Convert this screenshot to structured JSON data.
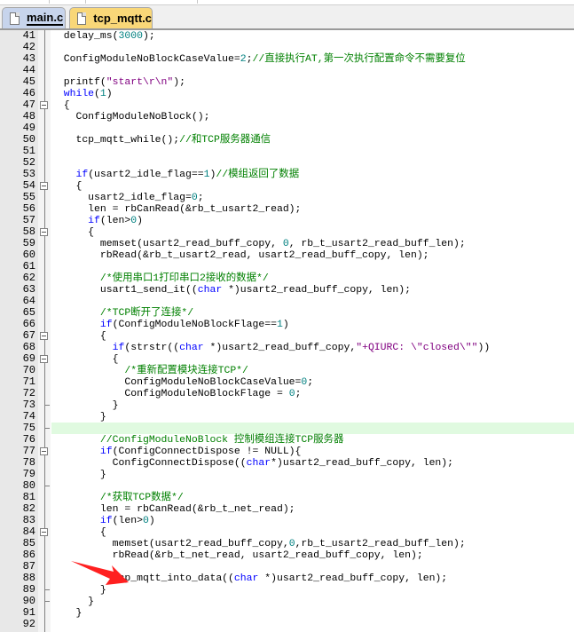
{
  "tabs": [
    {
      "label": "main.c",
      "active": false
    },
    {
      "label": "tcp_mqtt.c",
      "active": true
    }
  ],
  "colors": {
    "keyword": "#0000ff",
    "number": "#008080",
    "string": "#800080",
    "comment": "#008000",
    "highlight_line": "#e0fae0",
    "annotation_arrow": "#ff2020"
  },
  "highlighted_line": 75,
  "arrow_points_to_line": 88,
  "lines": [
    {
      "n": 41,
      "t": [
        [
          "p",
          "  delay_ms("
        ],
        [
          "n",
          "3000"
        ],
        [
          "p",
          ");"
        ]
      ]
    },
    {
      "n": 42,
      "t": []
    },
    {
      "n": 43,
      "t": [
        [
          "p",
          "  ConfigModuleNoBlockCaseValue="
        ],
        [
          "n",
          "2"
        ],
        [
          "p",
          ";"
        ],
        [
          "c",
          "//直接执行AT,第一次执行配置命令不需要复位"
        ]
      ]
    },
    {
      "n": 44,
      "t": []
    },
    {
      "n": 45,
      "t": [
        [
          "p",
          "  printf("
        ],
        [
          "s",
          "\"start\\r\\n\""
        ],
        [
          "p",
          ");"
        ]
      ]
    },
    {
      "n": 46,
      "t": [
        [
          "k",
          "  while"
        ],
        [
          "p",
          "("
        ],
        [
          "n",
          "1"
        ],
        [
          "p",
          ")"
        ]
      ]
    },
    {
      "n": 47,
      "fold": "box",
      "t": [
        [
          "p",
          "  {"
        ]
      ]
    },
    {
      "n": 48,
      "t": [
        [
          "p",
          "    ConfigModuleNoBlock();"
        ]
      ]
    },
    {
      "n": 49,
      "t": []
    },
    {
      "n": 50,
      "t": [
        [
          "p",
          "    tcp_mqtt_while();"
        ],
        [
          "c",
          "//和TCP服务器通信"
        ]
      ]
    },
    {
      "n": 51,
      "t": []
    },
    {
      "n": 52,
      "t": []
    },
    {
      "n": 53,
      "t": [
        [
          "k",
          "    if"
        ],
        [
          "p",
          "(usart2_idle_flag=="
        ],
        [
          "n",
          "1"
        ],
        [
          "p",
          ")"
        ],
        [
          "c",
          "//模组返回了数据"
        ]
      ]
    },
    {
      "n": 54,
      "fold": "box",
      "t": [
        [
          "p",
          "    {"
        ]
      ]
    },
    {
      "n": 55,
      "t": [
        [
          "p",
          "      usart2_idle_flag="
        ],
        [
          "n",
          "0"
        ],
        [
          "p",
          ";"
        ]
      ]
    },
    {
      "n": 56,
      "t": [
        [
          "p",
          "      len = rbCanRead(&rb_t_usart2_read);"
        ]
      ]
    },
    {
      "n": 57,
      "t": [
        [
          "k",
          "      if"
        ],
        [
          "p",
          "(len>"
        ],
        [
          "n",
          "0"
        ],
        [
          "p",
          ")"
        ]
      ]
    },
    {
      "n": 58,
      "fold": "box",
      "t": [
        [
          "p",
          "      {"
        ]
      ]
    },
    {
      "n": 59,
      "t": [
        [
          "p",
          "        memset(usart2_read_buff_copy, "
        ],
        [
          "n",
          "0"
        ],
        [
          "p",
          ", rb_t_usart2_read_buff_len);"
        ]
      ]
    },
    {
      "n": 60,
      "t": [
        [
          "p",
          "        rbRead(&rb_t_usart2_read, usart2_read_buff_copy, len);"
        ]
      ]
    },
    {
      "n": 61,
      "t": []
    },
    {
      "n": 62,
      "t": [
        [
          "c",
          "        /*使用串口1打印串口2接收的数据*/"
        ]
      ]
    },
    {
      "n": 63,
      "t": [
        [
          "p",
          "        usart1_send_it(("
        ],
        [
          "k",
          "char"
        ],
        [
          "p",
          " *)usart2_read_buff_copy, len);"
        ]
      ]
    },
    {
      "n": 64,
      "t": []
    },
    {
      "n": 65,
      "t": [
        [
          "c",
          "        /*TCP断开了连接*/"
        ]
      ]
    },
    {
      "n": 66,
      "t": [
        [
          "k",
          "        if"
        ],
        [
          "p",
          "(ConfigModuleNoBlockFlage=="
        ],
        [
          "n",
          "1"
        ],
        [
          "p",
          ")"
        ]
      ]
    },
    {
      "n": 67,
      "fold": "box",
      "t": [
        [
          "p",
          "        {"
        ]
      ]
    },
    {
      "n": 68,
      "t": [
        [
          "k",
          "          if"
        ],
        [
          "p",
          "(strstr(("
        ],
        [
          "k",
          "char"
        ],
        [
          "p",
          " *)usart2_read_buff_copy,"
        ],
        [
          "s",
          "\"+QIURC: \\\"closed\\\"\""
        ],
        [
          "p",
          "))"
        ]
      ]
    },
    {
      "n": 69,
      "fold": "box",
      "t": [
        [
          "p",
          "          {"
        ]
      ]
    },
    {
      "n": 70,
      "t": [
        [
          "c",
          "            /*重新配置模块连接TCP*/"
        ]
      ]
    },
    {
      "n": 71,
      "t": [
        [
          "p",
          "            ConfigModuleNoBlockCaseValue="
        ],
        [
          "n",
          "0"
        ],
        [
          "p",
          ";"
        ]
      ]
    },
    {
      "n": 72,
      "t": [
        [
          "p",
          "            ConfigModuleNoBlockFlage = "
        ],
        [
          "n",
          "0"
        ],
        [
          "p",
          ";"
        ]
      ]
    },
    {
      "n": 73,
      "fold": "tick",
      "t": [
        [
          "p",
          "          }"
        ]
      ]
    },
    {
      "n": 74,
      "t": [
        [
          "p",
          "        }"
        ]
      ]
    },
    {
      "n": 75,
      "fold": "tick",
      "t": []
    },
    {
      "n": 76,
      "t": [
        [
          "c",
          "        //ConfigModuleNoBlock 控制模组连接TCP服务器"
        ]
      ]
    },
    {
      "n": 77,
      "fold": "box",
      "t": [
        [
          "k",
          "        if"
        ],
        [
          "p",
          "(ConfigConnectDispose != NULL){"
        ]
      ]
    },
    {
      "n": 78,
      "t": [
        [
          "p",
          "          ConfigConnectDispose(("
        ],
        [
          "k",
          "char"
        ],
        [
          "p",
          "*)usart2_read_buff_copy, len);"
        ]
      ]
    },
    {
      "n": 79,
      "t": [
        [
          "p",
          "        }"
        ]
      ]
    },
    {
      "n": 80,
      "fold": "tick",
      "t": []
    },
    {
      "n": 81,
      "t": [
        [
          "c",
          "        /*获取TCP数据*/"
        ]
      ]
    },
    {
      "n": 82,
      "t": [
        [
          "p",
          "        len = rbCanRead(&rb_t_net_read);"
        ]
      ]
    },
    {
      "n": 83,
      "t": [
        [
          "k",
          "        if"
        ],
        [
          "p",
          "(len>"
        ],
        [
          "n",
          "0"
        ],
        [
          "p",
          ")"
        ]
      ]
    },
    {
      "n": 84,
      "fold": "box",
      "t": [
        [
          "p",
          "        {"
        ]
      ]
    },
    {
      "n": 85,
      "t": [
        [
          "p",
          "          memset(usart2_read_buff_copy,"
        ],
        [
          "n",
          "0"
        ],
        [
          "p",
          ",rb_t_usart2_read_buff_len);"
        ]
      ]
    },
    {
      "n": 86,
      "t": [
        [
          "p",
          "          rbRead(&rb_t_net_read, usart2_read_buff_copy, len);"
        ]
      ]
    },
    {
      "n": 87,
      "t": []
    },
    {
      "n": 88,
      "t": [
        [
          "p",
          "          tcp_mqtt_into_data(("
        ],
        [
          "k",
          "char"
        ],
        [
          "p",
          " *)usart2_read_buff_copy, len);"
        ]
      ]
    },
    {
      "n": 89,
      "fold": "tick",
      "t": [
        [
          "p",
          "        }"
        ]
      ]
    },
    {
      "n": 90,
      "fold": "tick",
      "t": [
        [
          "p",
          "      }"
        ]
      ]
    },
    {
      "n": 91,
      "t": [
        [
          "p",
          "    }"
        ]
      ]
    },
    {
      "n": 92,
      "t": []
    }
  ]
}
